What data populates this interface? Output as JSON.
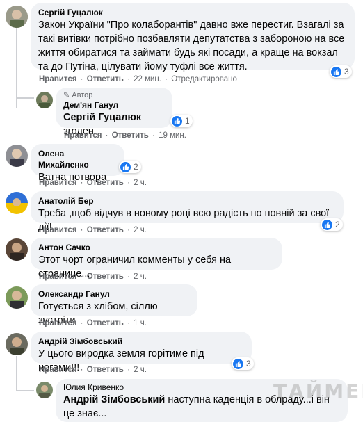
{
  "labels": {
    "like": "Нравится",
    "reply": "Ответить",
    "edited": "Отредактировано",
    "author_badge": "Автор",
    "separator": "·"
  },
  "comments": [
    {
      "author": "Сергій Гуцалюк",
      "text": "Закон України \"Про колаборантів\" давно вже перестиг. Взагалі за такі витівки потрібно позбавляти депутатства з забороною на все життя обиратися та займати будь які посади, а краще на вокзал та до Путіна, цілувати йому туфлі все життя.",
      "time": "22 мин.",
      "likes": "3"
    },
    {
      "author": "Дем'ян Ганул",
      "mention": "Сергій Гуцалюк",
      "text": " згоден",
      "time": "19 мин.",
      "likes": "1"
    },
    {
      "author": "Олена Михайленко",
      "text": "Ватна потвора",
      "time": "2 ч.",
      "likes": "2"
    },
    {
      "author": "Анатолій Бер",
      "text": "Треба ,щоб відчув в новому році всю радість по повній за свої дії!",
      "time": "2 ч.",
      "likes": "2"
    },
    {
      "author": "Антон Сачко",
      "text": "Этот чорт ограничил комменты у себя на странице...",
      "time": "2 ч."
    },
    {
      "author": "Олександр Ганул",
      "text": "Готується з хлібом, сіллю зустріти",
      "time": "1 ч."
    },
    {
      "author": "Андрій Зімбовський",
      "text": "У цього виродка земля горітиме під ногами!!!",
      "time": "2 ч.",
      "likes": "3"
    },
    {
      "author": "Юлия Кривенко",
      "mention": "Андрій Зімбовський",
      "text": " наступна каденція в облраду...і він це знає..."
    }
  ],
  "watermark": "ТАЙМЕР",
  "colors": {
    "bubble": "#f0f2f5",
    "like_blue": "#1877f2",
    "meta_gray": "#65676b"
  }
}
